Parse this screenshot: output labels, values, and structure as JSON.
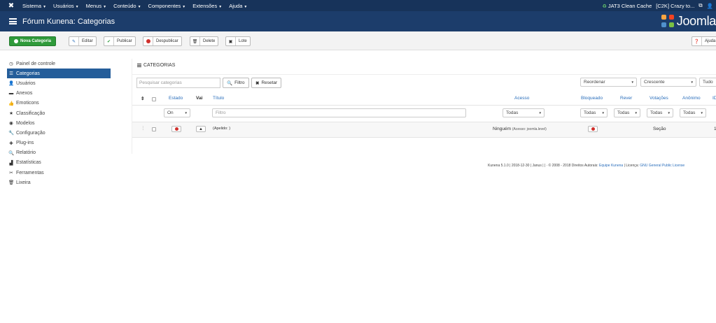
{
  "navbar": {
    "menu": [
      "Sistema",
      "Usuários",
      "Menus",
      "Conteúdo",
      "Componentes",
      "Extensões",
      "Ajuda"
    ],
    "cache_label": "JAT3 Clean Cache",
    "user_label": "[C2K] Crazy to..."
  },
  "header": {
    "title": "Fórum Kunena: Categorias",
    "logo_text": "Joomla"
  },
  "toolbar": {
    "new_label": "Nova Categoria",
    "edit_label": "Editar",
    "publish_label": "Publicar",
    "unpublish_label": "Despublicar",
    "delete_label": "Delete",
    "batch_label": "Lote",
    "help_label": "Ajuda"
  },
  "sidebar": {
    "items": [
      {
        "label": "Painel de controle",
        "icon": "dashboard-icon"
      },
      {
        "label": "Categorias",
        "icon": "list-icon"
      },
      {
        "label": "Usuários",
        "icon": "user-icon"
      },
      {
        "label": "Anexos",
        "icon": "folder-icon"
      },
      {
        "label": "Emoticons",
        "icon": "thumbs-up-icon"
      },
      {
        "label": "Classificação",
        "icon": "star-icon"
      },
      {
        "label": "Modelos",
        "icon": "eye-icon"
      },
      {
        "label": "Configuração",
        "icon": "wrench-icon"
      },
      {
        "label": "Plug-ins",
        "icon": "puzzle-icon"
      },
      {
        "label": "Relatório",
        "icon": "search-icon"
      },
      {
        "label": "Estatísticas",
        "icon": "bar-chart-icon"
      },
      {
        "label": "Ferramentas",
        "icon": "tools-icon"
      },
      {
        "label": "Lixeira",
        "icon": "trash-icon"
      }
    ]
  },
  "panel": {
    "title": "CATEGORIAS",
    "search_placeholder": "Pesquisar categorias",
    "filter_label": "Filtro",
    "reset_label": "Resetar",
    "order_select": "Reordenar",
    "direction_select": "Crescente",
    "limit_select": "Tudo"
  },
  "table": {
    "headers": {
      "estado": "Estado",
      "vai": "Vai",
      "titulo": "Título",
      "acesso": "Acesso",
      "bloqueado": "Bloqueado",
      "rever": "Rever",
      "votacoes": "Votações",
      "anonimo": "Anônimo",
      "id": "ID"
    },
    "filters": {
      "estado": "On",
      "titulo_placeholder": "Filtro",
      "acesso": "Todas",
      "bloqueado": "Todas",
      "rever": "Todas",
      "votacoes": "Todas",
      "anonimo": "Todas"
    },
    "rows": [
      {
        "title": "(Apelido: )",
        "access": "Ninguém",
        "access_note": "(Acesso: joomla.level)",
        "votes": "Seção",
        "id": "1"
      }
    ]
  },
  "footer": {
    "text": "Kunena 5.1.0 | 2018-12-30 | Janus | | · © 2008 - 2018 Direitos Autorais:",
    "team_link": "Equipe Kunena",
    "license_text": "| Licença:",
    "license_link": "GNU General Public License"
  }
}
